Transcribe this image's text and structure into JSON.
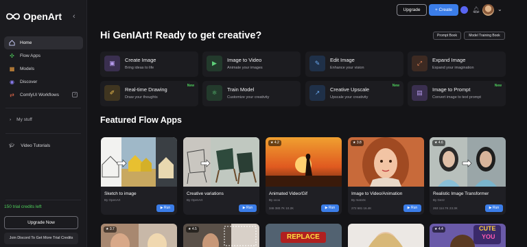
{
  "brand": {
    "name": "OpenArt"
  },
  "sidebar": {
    "items": [
      {
        "label": "Home",
        "icon": "home-icon",
        "active": true
      },
      {
        "label": "Flow Apps",
        "icon": "flow-icon"
      },
      {
        "label": "Models",
        "icon": "grid-icon"
      },
      {
        "label": "Discover",
        "icon": "compass-icon"
      },
      {
        "label": "ComfyUI Workflows",
        "icon": "workflow-icon"
      }
    ],
    "my_stuff": "My stuff",
    "tutorials": "Video Tutorials",
    "credits": "150 trial credits left",
    "upgrade_now": "Upgrade Now",
    "discord": "Join Discord To Get More Trial Credits"
  },
  "topbar": {
    "upgrade": "Upgrade",
    "create": "+ Create"
  },
  "greeting": "Hi GenIArt! Ready to get creative?",
  "pills": {
    "prompt_book": "Prompt Book",
    "model_training_book": "Model Training Book"
  },
  "tools": [
    {
      "title": "Create Image",
      "sub": "Bring ideas to life",
      "color": "#3a2f4f",
      "glyph": "▣",
      "new": ""
    },
    {
      "title": "Image to Video",
      "sub": "Animate your images",
      "color": "#233a2c",
      "glyph": "▶",
      "new": ""
    },
    {
      "title": "Edit Image",
      "sub": "Enhance your vision",
      "color": "#1f3048",
      "glyph": "✎",
      "new": ""
    },
    {
      "title": "Expand Image",
      "sub": "Expand your imagination",
      "color": "#3d2a22",
      "glyph": "⤢",
      "new": ""
    },
    {
      "title": "Real-time Drawing",
      "sub": "Draw your thoughts",
      "color": "#3f3520",
      "glyph": "✐",
      "new": "New"
    },
    {
      "title": "Train Model",
      "sub": "Customize your creativity",
      "color": "#233a2c",
      "glyph": "⚛",
      "new": ""
    },
    {
      "title": "Creative Upscale",
      "sub": "Upscale your creativity",
      "color": "#1f3048",
      "glyph": "↗",
      "new": "New"
    },
    {
      "title": "Image to Prompt",
      "sub": "Convert image to text prompt",
      "color": "#3a2f4f",
      "glyph": "▤",
      "new": "New"
    }
  ],
  "featured_title": "Featured Flow Apps",
  "flow_apps": [
    {
      "title": "Sketch to image",
      "by": "By OpenArt",
      "rating": "",
      "stats": "",
      "run": "▶ Run"
    },
    {
      "title": "Creative variations",
      "by": "By OpenArt",
      "rating": "",
      "stats": "",
      "run": "▶ Run"
    },
    {
      "title": "Animated Video/Gif",
      "by": "By ocoo",
      "rating": "4.2",
      "stats": "346   380.7K   10.2K",
      "run": "▶ Run"
    },
    {
      "title": "Image to Video/Animation",
      "by": "By mat10c",
      "rating": "3.8",
      "stats": "272   681   16.4K",
      "run": "▶ Run"
    },
    {
      "title": "Realistic Image Transformer",
      "by": "By Gezz",
      "rating": "4.6",
      "stats": "263   114.7K   23.3K",
      "run": "▶ Run"
    }
  ],
  "bottom_ratings": [
    "3.7",
    "4.5",
    "",
    "",
    "4.4"
  ],
  "bottom_text": {
    "replace": "REPLACE",
    "cute": "CUTE",
    "you": "YOU"
  }
}
